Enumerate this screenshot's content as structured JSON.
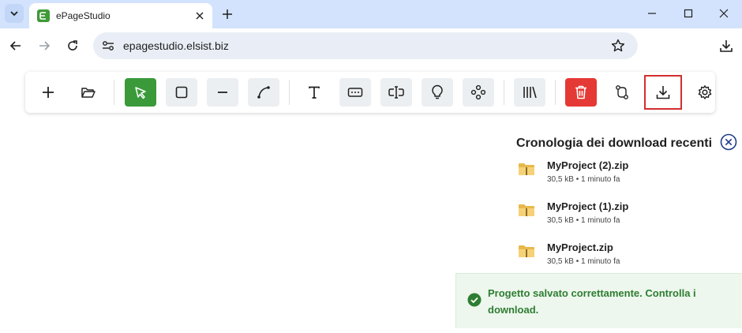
{
  "browser": {
    "tab_title": "ePageStudio",
    "url": "epagestudio.elsist.biz"
  },
  "toolbar": {
    "buttons": [
      {
        "name": "add-button",
        "icon": "plus-icon"
      },
      {
        "name": "open-folder-button",
        "icon": "folder-open-icon"
      },
      {
        "name": "select-tool-button",
        "icon": "cursor-arrow-icon"
      },
      {
        "name": "rectangle-tool-button",
        "icon": "square-icon"
      },
      {
        "name": "line-tool-button",
        "icon": "minus-icon"
      },
      {
        "name": "curve-tool-button",
        "icon": "curve-icon"
      },
      {
        "name": "text-tool-button",
        "icon": "text-icon"
      },
      {
        "name": "input-field-button",
        "icon": "textbox-icon"
      },
      {
        "name": "text-input-button",
        "icon": "text-cursor-icon"
      },
      {
        "name": "lamp-button",
        "icon": "lightbulb-icon"
      },
      {
        "name": "gamepad-button",
        "icon": "gamepad-icon"
      },
      {
        "name": "library-button",
        "icon": "library-icon"
      },
      {
        "name": "delete-button",
        "icon": "trash-icon"
      },
      {
        "name": "routing-button",
        "icon": "route-icon"
      },
      {
        "name": "download-button",
        "icon": "download-icon"
      },
      {
        "name": "settings-button",
        "icon": "gear-icon"
      }
    ],
    "colors": {
      "active": "#3a9a3a",
      "danger": "#e53935",
      "highlight_border": "#d32f2f"
    }
  },
  "downloads": {
    "title": "Cronologia dei download recenti",
    "items": [
      {
        "filename": "MyProject (2).zip",
        "meta": "30,5 kB • 1 minuto fa"
      },
      {
        "filename": "MyProject (1).zip",
        "meta": "30,5 kB • 1 minuto fa"
      },
      {
        "filename": "MyProject.zip",
        "meta": "30,5 kB • 1 minuto fa"
      }
    ]
  },
  "toast": {
    "message": "Progetto salvato correttamente. Controlla i download."
  }
}
